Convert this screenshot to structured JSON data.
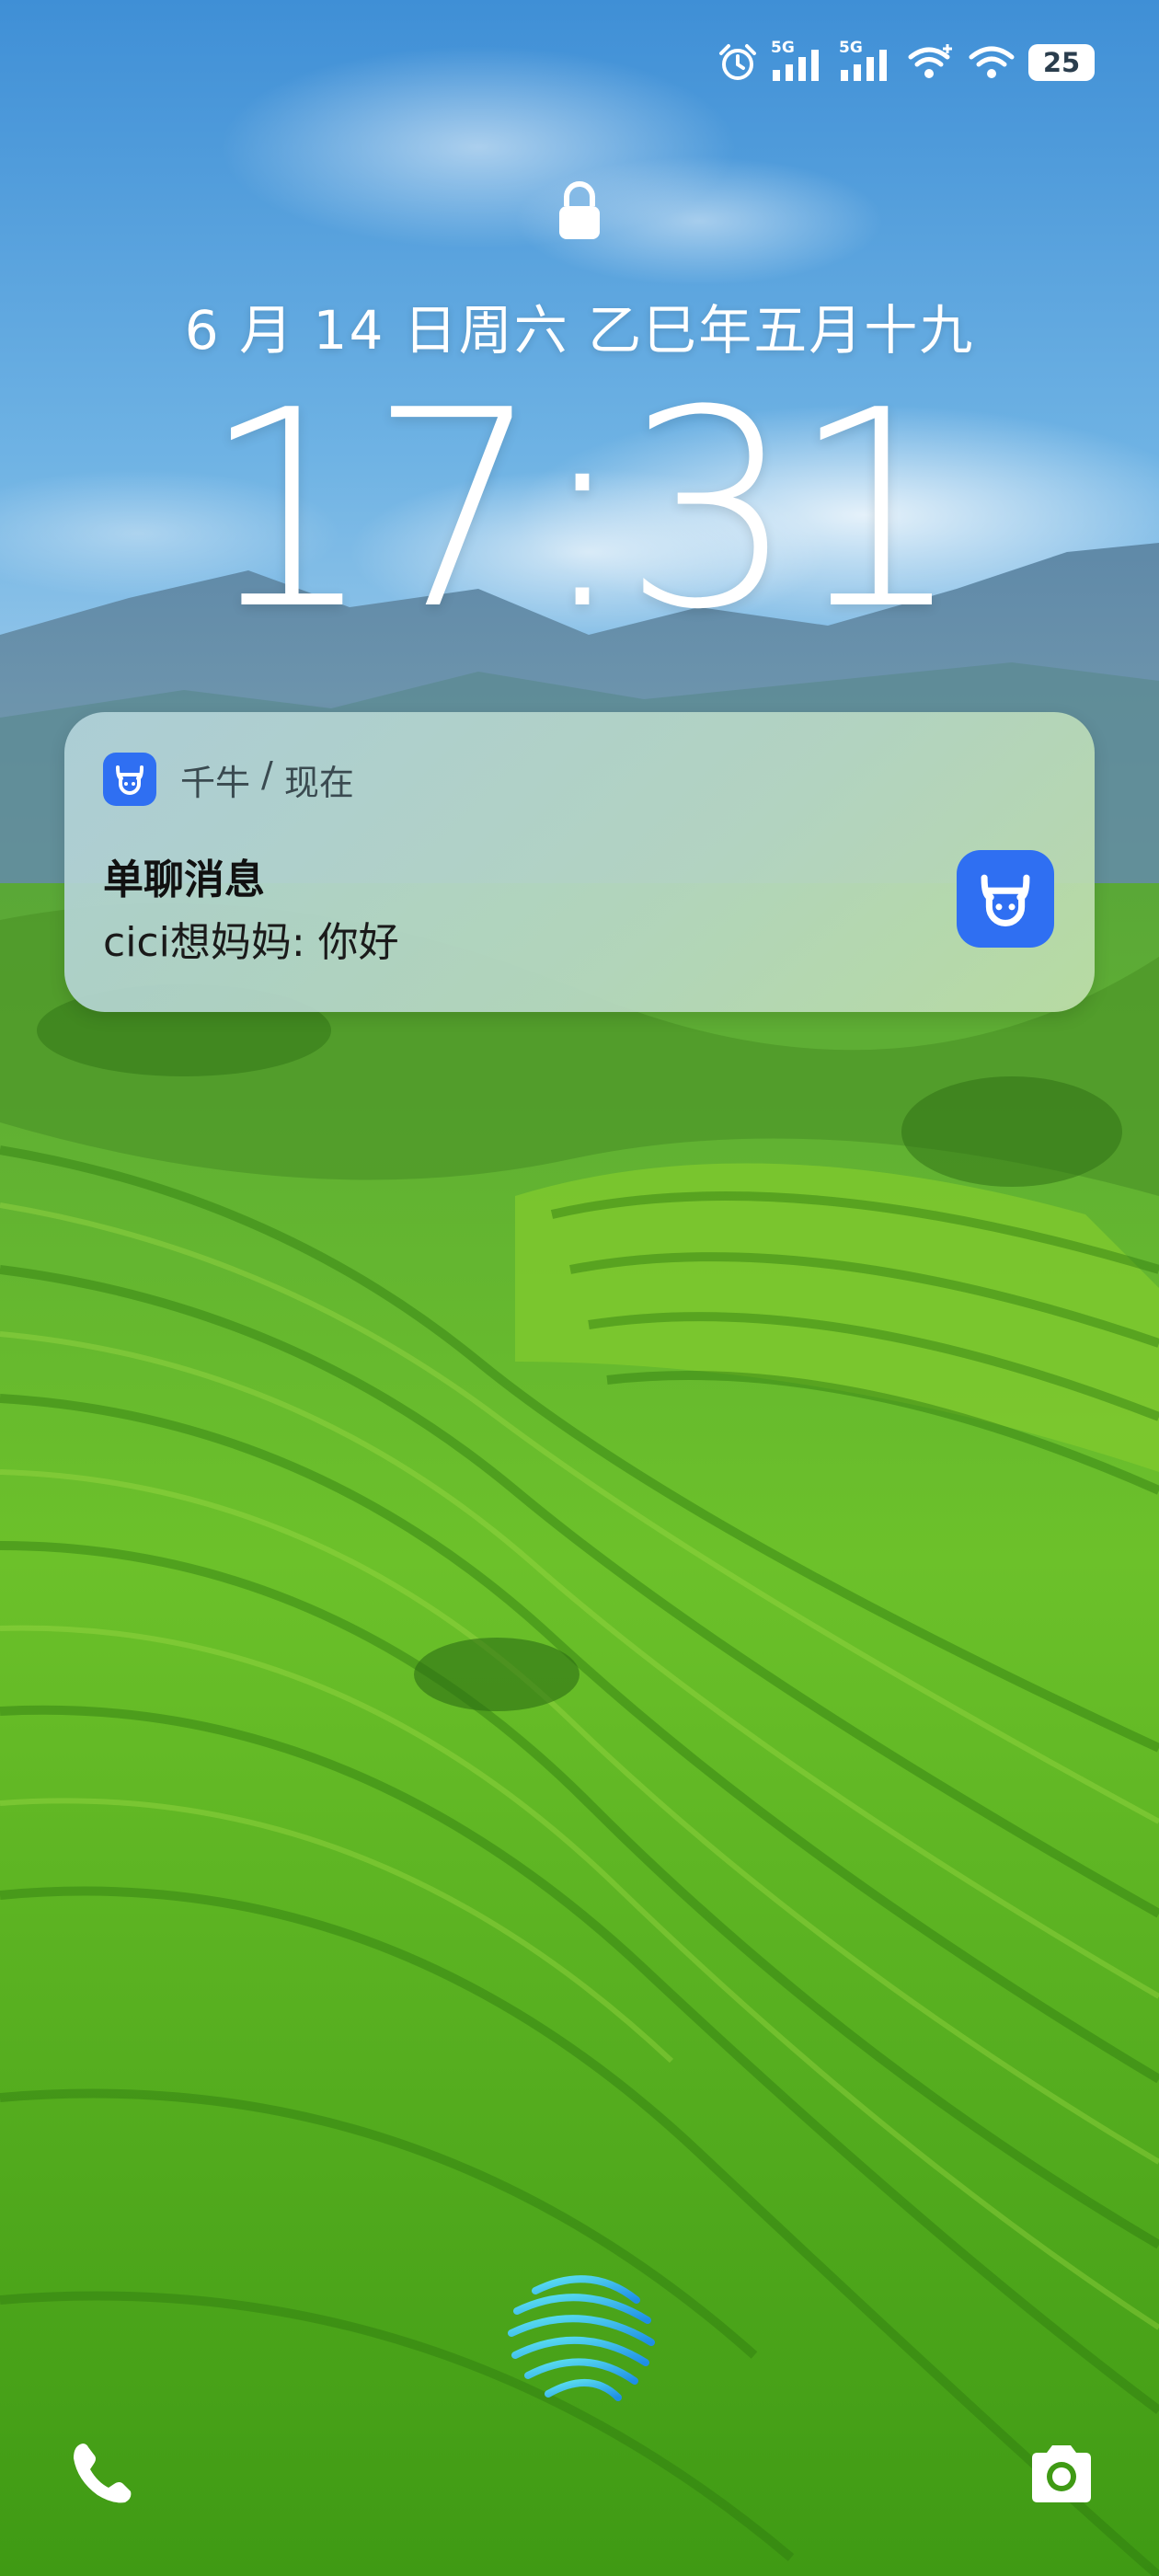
{
  "status_bar": {
    "alarm_icon": "alarm-clock-icon",
    "sim1_label": "5G",
    "sim2_label": "5G",
    "wifi1_icon": "wifi-plus-icon",
    "wifi2_icon": "wifi-icon",
    "battery_level": "25"
  },
  "lock_screen": {
    "lock_icon": "lock-icon",
    "date": "6 月 14 日周六 乙巳年五月十九",
    "time": "17:31"
  },
  "notification": {
    "app_name": "千牛",
    "separator": "/",
    "time": "现在",
    "title": "单聊消息",
    "body": "cici想妈妈: 你好",
    "app_color": "#2f6ff2"
  },
  "bottom": {
    "left_shortcut_icon": "phone-icon",
    "center_logo": "swirl-logo-icon",
    "right_shortcut_icon": "camera-icon"
  }
}
